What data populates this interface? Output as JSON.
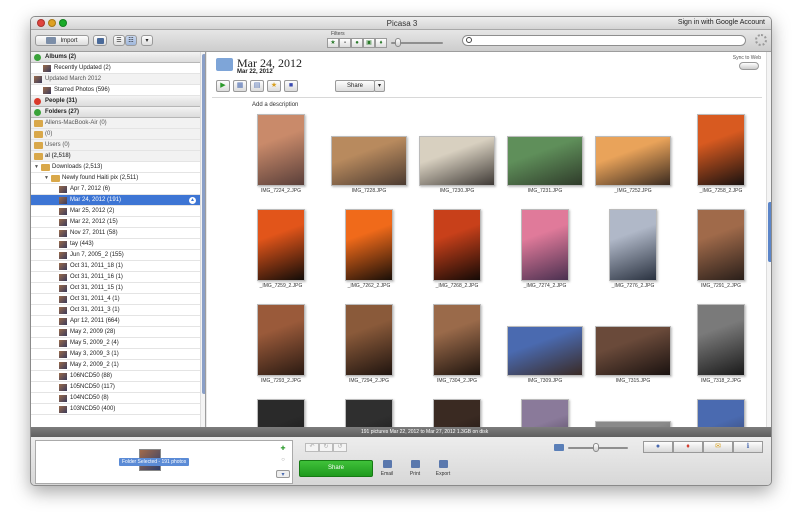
{
  "window": {
    "title": "Picasa 3",
    "sign_in": "Sign in with Google Account"
  },
  "toolbar": {
    "import_label": "Import",
    "filters_label": "Filters",
    "search": {
      "value": "",
      "placeholder": ""
    }
  },
  "sidebar": {
    "rows": [
      {
        "kind": "header",
        "label": "Albums (2)",
        "color": "#3aa33a"
      },
      {
        "kind": "item",
        "label": "Recently Updated (2)",
        "indent": 12
      },
      {
        "kind": "section",
        "label": "Updated March 2012",
        "indent": 3
      },
      {
        "kind": "item",
        "label": "Starred Photos (596)",
        "indent": 12
      },
      {
        "kind": "header",
        "label": "People (31)",
        "color": "#d93a2b"
      },
      {
        "kind": "header",
        "label": "Folders (27)",
        "color": "#3aa33a"
      },
      {
        "kind": "section",
        "label": "Allens-MacBook-Air (0)",
        "indent": 3,
        "folder": true
      },
      {
        "kind": "section",
        "label": "(0)",
        "indent": 3,
        "folder": true
      },
      {
        "kind": "section",
        "label": "Users (0)",
        "indent": 3,
        "folder": true
      },
      {
        "kind": "section",
        "label": "al (2,518)",
        "indent": 3,
        "folder": true,
        "bold": true
      },
      {
        "kind": "item",
        "label": "Downloads (2,513)",
        "indent": 10,
        "folder": true,
        "tri": true
      },
      {
        "kind": "item",
        "label": "Newly found Haiti pix (2,511)",
        "indent": 20,
        "folder": true,
        "tri": true
      },
      {
        "kind": "item",
        "label": "Apr 7, 2012 (6)",
        "indent": 28
      },
      {
        "kind": "item",
        "label": "Mar 24, 2012 (191)",
        "indent": 28,
        "selected": true
      },
      {
        "kind": "item",
        "label": "Mar 25, 2012 (2)",
        "indent": 28
      },
      {
        "kind": "item",
        "label": "Mar 22, 2012 (15)",
        "indent": 28
      },
      {
        "kind": "item",
        "label": "Nov 27, 2011 (58)",
        "indent": 28
      },
      {
        "kind": "item",
        "label": "tay (443)",
        "indent": 28
      },
      {
        "kind": "item",
        "label": "Jun 7, 2005_2 (155)",
        "indent": 28
      },
      {
        "kind": "item",
        "label": "Oct 31, 2011_18 (1)",
        "indent": 28
      },
      {
        "kind": "item",
        "label": "Oct 31, 2011_16 (1)",
        "indent": 28
      },
      {
        "kind": "item",
        "label": "Oct 31, 2011_15 (1)",
        "indent": 28
      },
      {
        "kind": "item",
        "label": "Oct 31, 2011_4 (1)",
        "indent": 28
      },
      {
        "kind": "item",
        "label": "Oct 31, 2011_3 (1)",
        "indent": 28
      },
      {
        "kind": "item",
        "label": "Apr 12, 2011 (664)",
        "indent": 28
      },
      {
        "kind": "item",
        "label": "May 2, 2009 (28)",
        "indent": 28
      },
      {
        "kind": "item",
        "label": "May 5, 2009_2 (4)",
        "indent": 28
      },
      {
        "kind": "item",
        "label": "May 3, 2009_3 (1)",
        "indent": 28
      },
      {
        "kind": "item",
        "label": "May 2, 2009_2 (1)",
        "indent": 28
      },
      {
        "kind": "item",
        "label": "106NCD50 (88)",
        "indent": 28
      },
      {
        "kind": "item",
        "label": "105NCD50 (117)",
        "indent": 28
      },
      {
        "kind": "item",
        "label": "104NCD50 (8)",
        "indent": 28
      },
      {
        "kind": "item",
        "label": "103NCD50 (400)",
        "indent": 28
      }
    ]
  },
  "album": {
    "title": "Mar 24, 2012",
    "date": "Mar 22, 2012",
    "sync_label": "Sync to Web",
    "share_label": "Share",
    "add_description": "Add a description"
  },
  "photos": [
    {
      "name": "IMG_7224_2.JPG",
      "orient": "portrait",
      "tone": [
        "#c98a6a",
        "#5a3f3a"
      ]
    },
    {
      "name": "IMG_7228.JPG",
      "orient": "landscape",
      "tone": [
        "#b88a5e",
        "#4b3a30"
      ]
    },
    {
      "name": "IMG_7230.JPG",
      "orient": "landscape",
      "tone": [
        "#d8d0c0",
        "#3f3a36"
      ]
    },
    {
      "name": "IMG_7231.JPG",
      "orient": "landscape",
      "tone": [
        "#5f8f5a",
        "#2f3b2a"
      ]
    },
    {
      "name": "_IMG_7252.JPG",
      "orient": "landscape",
      "tone": [
        "#e9a35a",
        "#3b2b20"
      ]
    },
    {
      "name": "_IMG_7258_2.JPG",
      "orient": "portrait",
      "tone": [
        "#d85a20",
        "#1a1210"
      ]
    },
    {
      "name": "_IMG_7259_2.JPG",
      "orient": "portrait",
      "tone": [
        "#e2551a",
        "#120c08"
      ]
    },
    {
      "name": "_IMG_7262_2.JPG",
      "orient": "portrait",
      "tone": [
        "#f06a1a",
        "#1a0f08"
      ]
    },
    {
      "name": "_IMG_7268_2.JPG",
      "orient": "portrait",
      "tone": [
        "#c8401a",
        "#150a06"
      ]
    },
    {
      "name": "_IMG_7274_2.JPG",
      "orient": "portrait",
      "tone": [
        "#e07a9a",
        "#4a3050"
      ]
    },
    {
      "name": "_IMG_7276_2.JPG",
      "orient": "portrait",
      "tone": [
        "#b0b8c8",
        "#2a3240"
      ]
    },
    {
      "name": "IMG_7291_2.JPG",
      "orient": "portrait",
      "tone": [
        "#a06a4a",
        "#2a1f1a"
      ]
    },
    {
      "name": "IMG_7293_2.JPG",
      "orient": "portrait",
      "tone": [
        "#9a5a3a",
        "#2a1a12"
      ]
    },
    {
      "name": "IMG_7294_2.JPG",
      "orient": "portrait",
      "tone": [
        "#8a5a3a",
        "#1f140f"
      ]
    },
    {
      "name": "IMG_7304_2.JPG",
      "orient": "portrait",
      "tone": [
        "#9a6a4a",
        "#20150f"
      ]
    },
    {
      "name": "IMG_7309.JPG",
      "orient": "landscape",
      "tone": [
        "#4a6ab0",
        "#3a2a25"
      ]
    },
    {
      "name": "IMG_7315.JPG",
      "orient": "landscape",
      "tone": [
        "#6a4a3a",
        "#1a1210"
      ]
    },
    {
      "name": "IMG_7318_2.JPG",
      "orient": "portrait",
      "tone": [
        "#7a7a7a",
        "#1a1a1a"
      ]
    },
    {
      "name": "",
      "orient": "portrait",
      "tone": [
        "#2a2a2a",
        "#0a0a0a"
      ]
    },
    {
      "name": "",
      "orient": "portrait",
      "tone": [
        "#2f2f2f",
        "#0a0a0a"
      ]
    },
    {
      "name": "",
      "orient": "portrait",
      "tone": [
        "#3a2a22",
        "#0a0808"
      ]
    },
    {
      "name": "",
      "orient": "portrait",
      "tone": [
        "#8a7a9a",
        "#2a2030"
      ]
    },
    {
      "name": "",
      "orient": "landscape",
      "tone": [
        "#8a8a8a",
        "#3a3a3a"
      ]
    },
    {
      "name": "",
      "orient": "portrait",
      "tone": [
        "#4a6ab0",
        "#2a2a3a"
      ]
    }
  ],
  "status": {
    "text": "191 pictures     Mar 22, 2012 to Mar 27, 2012     1.3GB on disk"
  },
  "tray": {
    "label": "Folder Selected - 191 photos"
  },
  "bottom": {
    "share_label": "Share",
    "email_label": "Email",
    "print_label": "Print",
    "export_label": "Export"
  },
  "colors": {
    "selection": "#3d75d4",
    "share_green": "#2aae28"
  }
}
